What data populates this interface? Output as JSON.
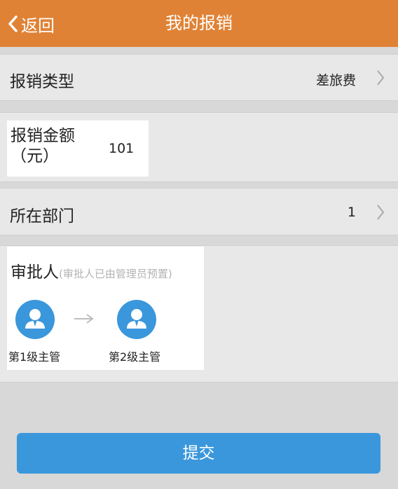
{
  "header": {
    "back_label": "返回",
    "title": "我的报销",
    "background_color": "#e08235"
  },
  "form": {
    "type_label": "报销类型",
    "type_value": "差旅费",
    "amount_label_line1": "报销金额",
    "amount_label_line2": "（元）",
    "amount_value": "101",
    "department_label": "所在部门",
    "department_value": "1"
  },
  "approvers": {
    "title": "审批人",
    "note": "(审批人已由管理员预置)",
    "levels": [
      {
        "label": "第1级主管",
        "icon": "user-avatar-icon"
      },
      {
        "label": "第2级主管",
        "icon": "user-avatar-icon"
      }
    ],
    "accent_color": "#3a97dc"
  },
  "actions": {
    "submit_label": "提交",
    "submit_color": "#3a97dc"
  }
}
